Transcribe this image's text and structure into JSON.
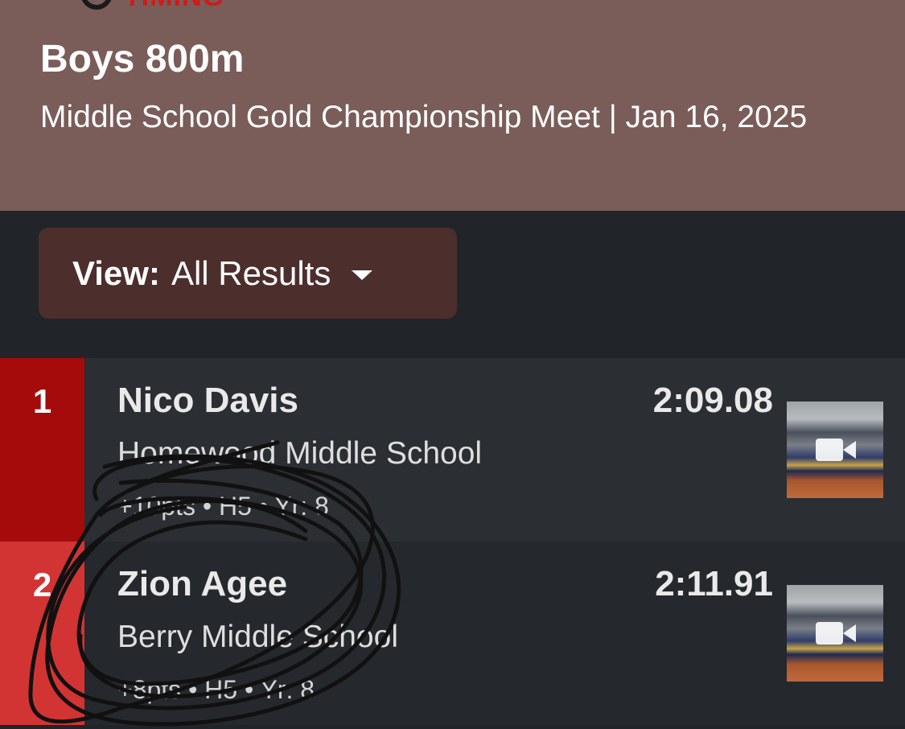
{
  "brand": {
    "logo_text": "TIMING"
  },
  "event": {
    "title": "Boys 800m",
    "subtitle": "Middle School Gold Championship Meet | Jan 16, 2025"
  },
  "view_filter": {
    "label": "View:",
    "value": "All Results"
  },
  "results": [
    {
      "place": "1",
      "name": "Nico Davis",
      "school": "Homewood Middle School",
      "time": "2:09.08",
      "meta": "+10pts • H5 • Yr: 8",
      "place_color": "#a50b0b"
    },
    {
      "place": "2",
      "name": "Zion Agee",
      "school": "Berry Middle School",
      "time": "2:11.91",
      "meta": "+8pts • H5 • Yr: 8",
      "place_color": "#d23333"
    }
  ],
  "icons": {
    "video": "video-camera-icon"
  }
}
